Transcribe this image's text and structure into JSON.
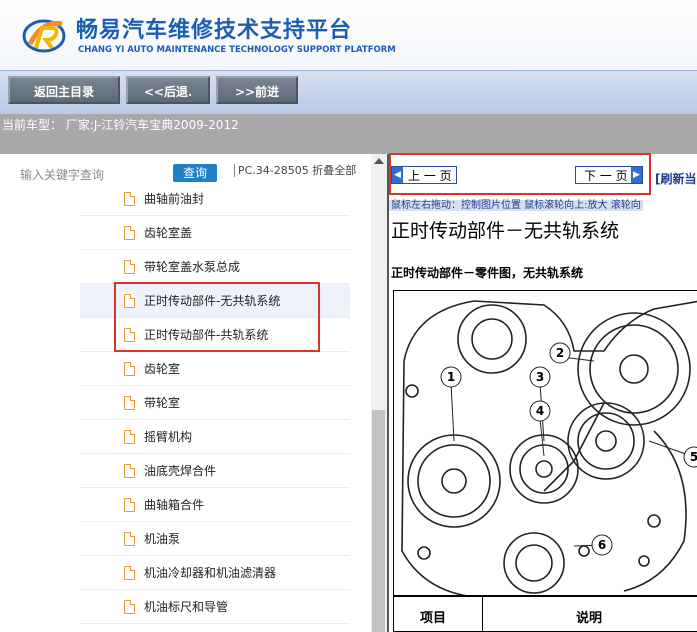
{
  "header": {
    "title_cn": "畅易汽车维修技术支持平台",
    "title_en": "CHANG YI AUTO MAINTENANCE TECHNOLOGY SUPPORT PLATFORM",
    "logo_icon": "cy-logo-icon"
  },
  "toolbar": {
    "home_label": "返回主目录",
    "back_label": "<<后退.",
    "forward_label": ">>前进"
  },
  "info": {
    "vehicle_text": "当前车型：  厂家:J-江铃汽车宝典2009-2012"
  },
  "sidebar": {
    "search_label": "输入关键字查询",
    "search_button": "查询",
    "pc_text": "PC.34-28505 折叠全部",
    "items": [
      {
        "label": "曲轴前油封"
      },
      {
        "label": "齿轮室盖"
      },
      {
        "label": "带轮室盖水泵总成"
      },
      {
        "label": "正时传动部件-无共轨系统"
      },
      {
        "label": "正时传动部件-共轨系统"
      },
      {
        "label": "齿轮室"
      },
      {
        "label": "带轮室"
      },
      {
        "label": "摇臂机构"
      },
      {
        "label": "油底壳焊合件"
      },
      {
        "label": "曲轴箱合件"
      },
      {
        "label": "机油泵"
      },
      {
        "label": "机油冷却器和机油滤清器"
      },
      {
        "label": "机油标尺和导管"
      }
    ]
  },
  "viewer": {
    "prev_label": "上 一 页",
    "next_label": "下 一 页",
    "refresh_label": "[刷新当",
    "hint_text": "鼠标左右拖动：控制图片位置  鼠标滚轮向上:放大  滚轮向",
    "doc_title": "正时传动部件－无共轨系统",
    "doc_subtitle": "正时传动部件－零件图，无共轨系统",
    "diagram_callouts": [
      "1",
      "2",
      "3",
      "4",
      "5",
      "6"
    ],
    "table_headers": [
      "项目",
      "说明"
    ]
  },
  "colors": {
    "brand_blue": "#1a5fb4",
    "highlight_red": "#d9342b",
    "toolbar_btn": "#6b7583"
  }
}
